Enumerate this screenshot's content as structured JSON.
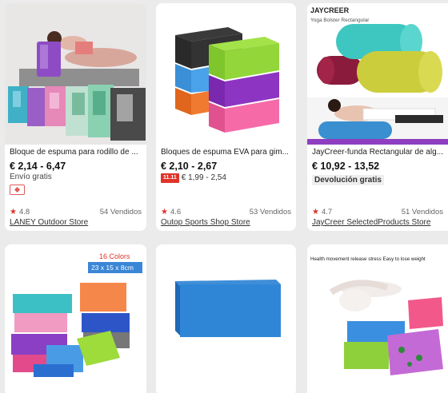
{
  "products": [
    {
      "title": "Bloque de espuma para rodillo de ...",
      "price": "€ 2,14 - 6,47",
      "shipping": "Envío gratis",
      "rating": "4.8",
      "sold": "54 Vendidos",
      "store": "LANEY Outdoor Store",
      "image_icon": "yoga-woman-foam-blocks-image"
    },
    {
      "title": "Bloques de espuma EVA para gim...",
      "price": "€ 2,10 - 2,67",
      "promo_tag": "11.11",
      "promo_price": "€ 1,99 - 2,54",
      "rating": "4.6",
      "sold": "53 Vendidos",
      "store": "Outop Sports Shop Store",
      "image_icon": "stacked-foam-blocks-image"
    },
    {
      "title": "JayCreer-funda Rectangular de alg...",
      "price": "€ 10,92 - 13,52",
      "badge": "Devolución gratis",
      "rating": "4.7",
      "sold": "51 Vendidos",
      "store": "JayCreer SelectedProducts Store",
      "image_brand": "JAYCREER",
      "image_caption": "Yoga Bolster Rectangular",
      "image_icon": "yoga-bolster-image"
    },
    {
      "image_caption": "16 Colors",
      "image_size": "23 x 15 x 8cm",
      "image_icon": "colored-yoga-blocks-image"
    },
    {
      "image_icon": "blue-yoga-block-image"
    },
    {
      "image_caption": "Health movement  release stress  Easy to lose weight",
      "image_icon": "yoga-pose-blocks-image"
    }
  ],
  "colors": {
    "accent_red": "#e0332a",
    "badge_bg": "#eeeeee",
    "page_bg": "#ebebeb"
  }
}
